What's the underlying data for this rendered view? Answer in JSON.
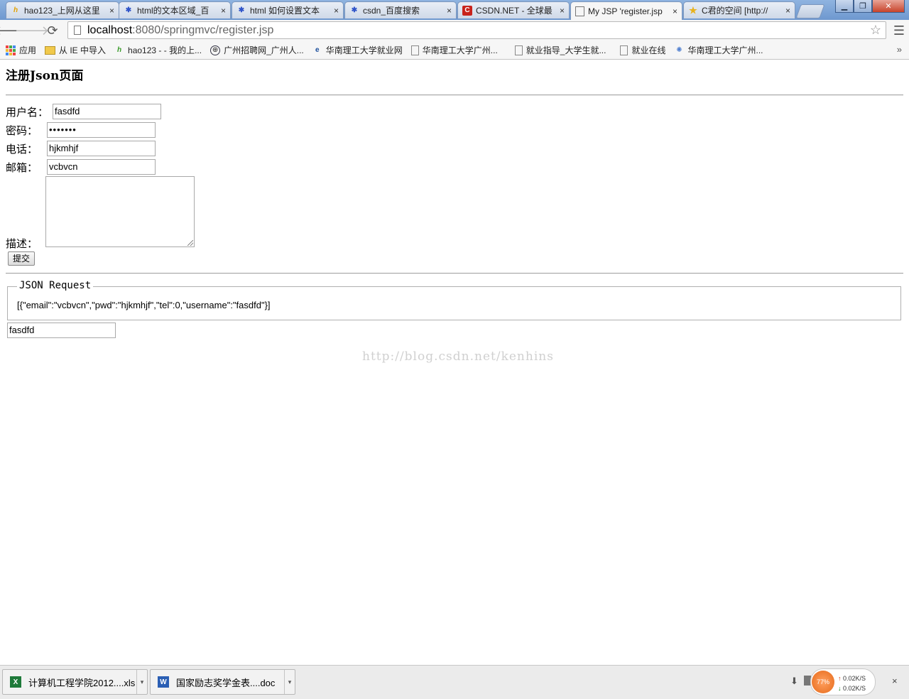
{
  "browser": {
    "tabs": [
      {
        "title": "hao123_上网从这里",
        "icon": "hao",
        "icon_color": "#e2a100",
        "active": false
      },
      {
        "title": "html的文本区域_百",
        "icon": "paw",
        "icon_color": "#2f54c9",
        "active": false
      },
      {
        "title": "html 如何设置文本",
        "icon": "paw",
        "icon_color": "#2f54c9",
        "active": false
      },
      {
        "title": "csdn_百度搜索",
        "icon": "paw",
        "icon_color": "#2f54c9",
        "active": false
      },
      {
        "title": "CSDN.NET - 全球最",
        "icon": "C",
        "icon_color": "#c8231c",
        "active": false
      },
      {
        "title": "My JSP 'register.jsp",
        "icon": "doc",
        "icon_color": "#777777",
        "active": true
      },
      {
        "title": "C君的空间 [http://",
        "icon": "star",
        "icon_color": "#e8b21e",
        "active": false
      }
    ],
    "close_glyph": "×",
    "url_host": "localhost",
    "url_path": ":8080/springmvc/register.jsp"
  },
  "bookmarks": [
    {
      "label": "应用",
      "icon": "apps"
    },
    {
      "label": "从 IE 中导入",
      "icon": "folder"
    },
    {
      "label": "hao123 - - 我的上...",
      "icon": "hao"
    },
    {
      "label": "广州招聘网_广州人...",
      "icon": "globe"
    },
    {
      "label": "华南理工大学就业网",
      "icon": "ie"
    },
    {
      "label": "华南理工大学广州...",
      "icon": "page"
    },
    {
      "label": "就业指导_大学生就...",
      "icon": "page"
    },
    {
      "label": "就业在线",
      "icon": "page"
    },
    {
      "label": "华南理工大学广州...",
      "icon": "globe2"
    }
  ],
  "bookmarks_more": "»",
  "page": {
    "heading": "注册Json页面",
    "form": {
      "username_label": "用户名：",
      "username_value": "fasdfd",
      "password_label": "密码：",
      "password_value": "•••••••",
      "phone_label": "电话：",
      "phone_value": "hjkmhjf",
      "email_label": "邮箱：",
      "email_value": "vcbvcn",
      "description_label": "描述：",
      "submit_label": "提交"
    },
    "json_legend": "JSON Request",
    "json_output": "[{\"email\":\"vcbvcn\",\"pwd\":\"hjkmhjf\",\"tel\":0,\"username\":\"fasdfd\"}]",
    "result_value": "fasdfd",
    "watermark": "http://blog.csdn.net/kenhins"
  },
  "downloads": [
    {
      "name": "计算机工程学院2012....xls",
      "type": "xls",
      "color": "#1f7a3a"
    },
    {
      "name": "国家励志奖学金表....doc",
      "type": "doc",
      "color": "#2b5fb4"
    }
  ],
  "tray": {
    "cpu_percent": "77%",
    "upload": "0.02K/S",
    "download": "0.02K/S",
    "up_arrow": "↑",
    "down_arrow": "↓"
  }
}
